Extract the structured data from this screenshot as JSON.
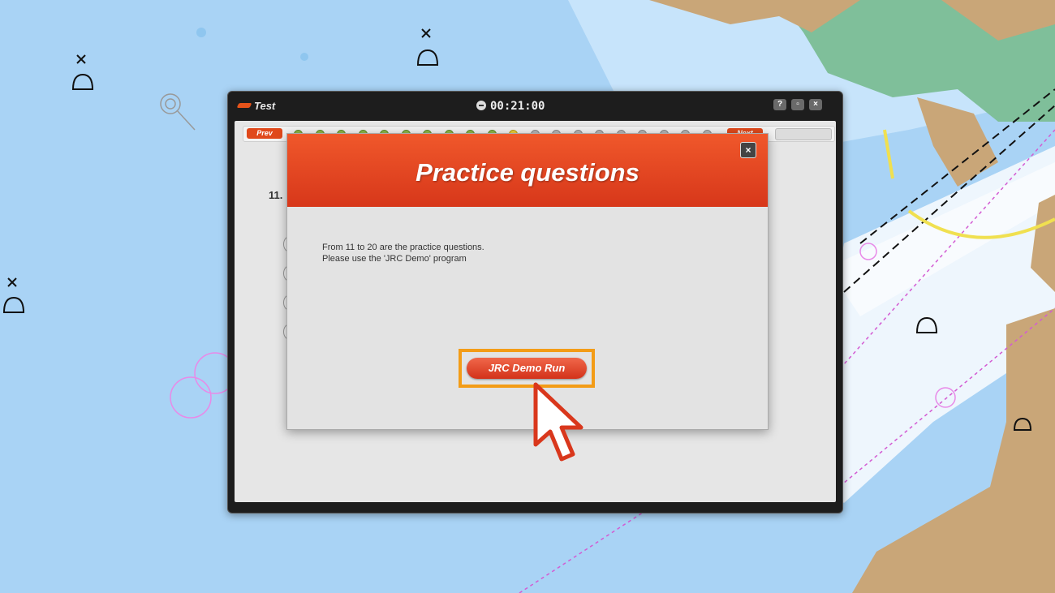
{
  "window": {
    "title": "Test",
    "timer": "00:21:00",
    "help_label": "?",
    "min_label": "▫",
    "close_label": "×"
  },
  "nav": {
    "prev_label": "Prev",
    "next_label": "Next",
    "question_number": "11."
  },
  "popup": {
    "title": "Practice questions",
    "close_label": "×",
    "message_line1": "From 11 to 20 are the practice questions.",
    "message_line2": "Please use the 'JRC Demo' program",
    "run_button_label": "JRC Demo Run"
  },
  "colors": {
    "accent": "#e0491b",
    "highlight": "#f39c17",
    "sea": "#a9d3f5",
    "land": "#c9a678"
  }
}
